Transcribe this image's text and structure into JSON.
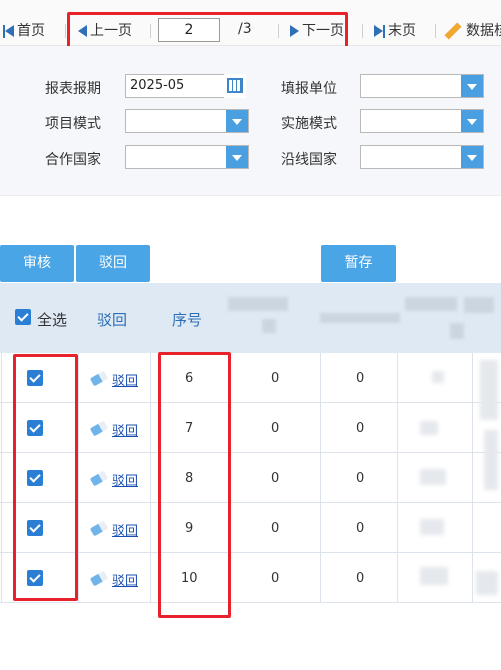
{
  "pager": {
    "first": "首页",
    "prev": "上一页",
    "page_value": "2",
    "total": "/3",
    "next": "下一页",
    "last": "末页",
    "data": "数据核"
  },
  "filters": {
    "report_period_label": "报表报期",
    "report_period_value": "2025-05",
    "fill_unit_label": "填报单位",
    "project_mode_label": "项目模式",
    "impl_mode_label": "实施模式",
    "partner_country_label": "合作国家",
    "route_country_label": "沿线国家"
  },
  "actions": {
    "review": "审核",
    "reject": "驳回",
    "save_draft": "暂存"
  },
  "table": {
    "headers": {
      "select_all": "全选",
      "reject": "驳回",
      "seq": "序号"
    },
    "reject_link": "驳回",
    "rows": [
      {
        "seq": "6",
        "c1": "0",
        "c2": "0",
        "checked": true
      },
      {
        "seq": "7",
        "c1": "0",
        "c2": "0",
        "checked": true
      },
      {
        "seq": "8",
        "c1": "0",
        "c2": "0",
        "checked": true
      },
      {
        "seq": "9",
        "c1": "0",
        "c2": "0",
        "checked": true
      },
      {
        "seq": "10",
        "c1": "0",
        "c2": "0",
        "checked": true
      }
    ]
  },
  "colors": {
    "accent": "#4aa5e6",
    "highlight": "#e8222a",
    "header_bg": "#dfe9f4"
  }
}
